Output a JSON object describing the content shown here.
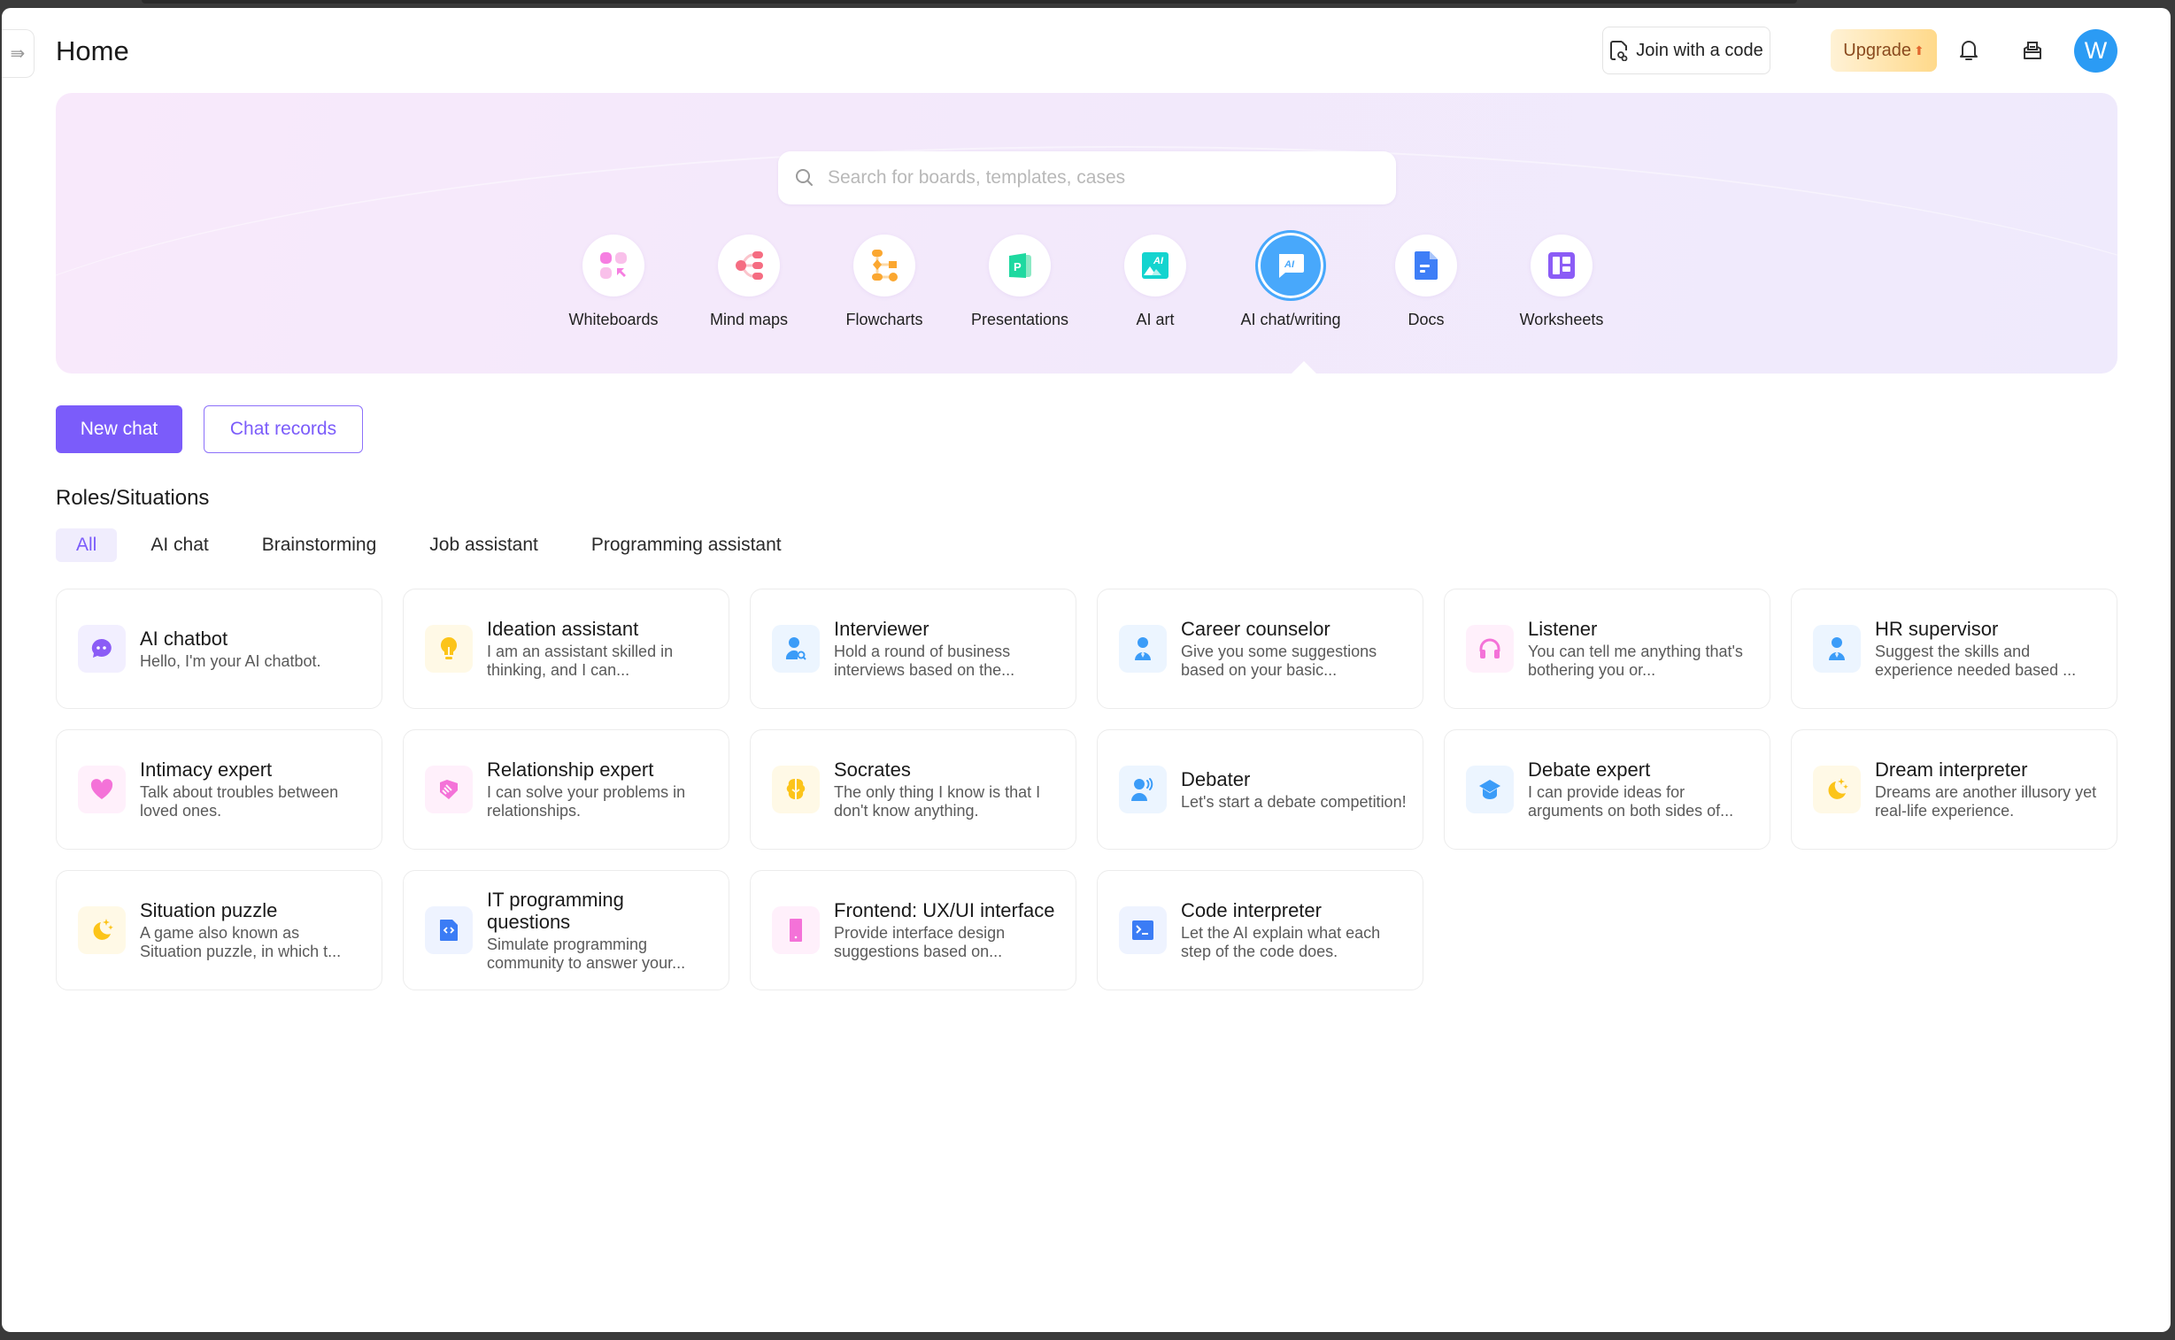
{
  "header": {
    "title": "Home",
    "join_label": "Join with a code",
    "upgrade_label": "Upgrade",
    "avatar_initial": "W"
  },
  "search": {
    "placeholder": "Search for boards, templates, cases",
    "value": ""
  },
  "categories": [
    {
      "label": "Whiteboards",
      "icon": "whiteboard-icon",
      "active": false
    },
    {
      "label": "Mind maps",
      "icon": "mind-map-icon",
      "active": false
    },
    {
      "label": "Flowcharts",
      "icon": "flowchart-icon",
      "active": false
    },
    {
      "label": "Presentations",
      "icon": "presentation-icon",
      "active": false
    },
    {
      "label": "AI art",
      "icon": "ai-art-icon",
      "active": false
    },
    {
      "label": "AI chat/writing",
      "icon": "ai-chat-icon",
      "active": true
    },
    {
      "label": "Docs",
      "icon": "doc-icon",
      "active": false
    },
    {
      "label": "Worksheets",
      "icon": "worksheet-icon",
      "active": false
    }
  ],
  "actions": {
    "new_chat": "New chat",
    "chat_records": "Chat records"
  },
  "roles": {
    "title": "Roles/Situations",
    "filters": [
      "All",
      "AI chat",
      "Brainstorming",
      "Job assistant",
      "Programming assistant"
    ],
    "active_filter": "All",
    "cards": [
      {
        "title": "AI chatbot",
        "desc": "Hello, I'm your AI chatbot.",
        "icon": "chat-bubble-icon",
        "color": "#8b5cf6"
      },
      {
        "title": "Ideation assistant",
        "desc": "I am an assistant skilled in thinking, and I can...",
        "icon": "lightbulb-icon",
        "color": "#fcc419"
      },
      {
        "title": "Interviewer",
        "desc": "Hold a round of business interviews based on the...",
        "icon": "person-search-icon",
        "color": "#3b9cf8"
      },
      {
        "title": "Career counselor",
        "desc": "Give you some suggestions based on your basic...",
        "icon": "person-icon",
        "color": "#3b9cf8"
      },
      {
        "title": "Listener",
        "desc": "You can tell me anything that's bothering you or...",
        "icon": "headphones-icon",
        "color": "#f472d8"
      },
      {
        "title": "HR supervisor",
        "desc": "Suggest the skills and experience needed based ...",
        "icon": "person-icon",
        "color": "#3b9cf8"
      },
      {
        "title": "Intimacy expert",
        "desc": "Talk about troubles between loved ones.",
        "icon": "heart-icon",
        "color": "#f472d8"
      },
      {
        "title": "Relationship expert",
        "desc": "I can solve your problems in relationships.",
        "icon": "handshake-icon",
        "color": "#f472d8"
      },
      {
        "title": "Socrates",
        "desc": "The only thing I know is that I don't know anything.",
        "icon": "brain-icon",
        "color": "#fcc419"
      },
      {
        "title": "Debater",
        "desc": "Let's start a debate competition!",
        "icon": "speaker-person-icon",
        "color": "#3b9cf8"
      },
      {
        "title": "Debate expert",
        "desc": "I can provide ideas for arguments on both sides of...",
        "icon": "graduation-cap-icon",
        "color": "#3b9cf8"
      },
      {
        "title": "Dream interpreter",
        "desc": "Dreams are another illusory yet real-life experience.",
        "icon": "moon-stars-icon",
        "color": "#fcc419"
      },
      {
        "title": "Situation puzzle",
        "desc": "A game also known as Situation puzzle, in which t...",
        "icon": "moon-stars-icon",
        "color": "#fcc419"
      },
      {
        "title": "IT programming questions",
        "desc": "Simulate programming community to answer your...",
        "icon": "code-file-icon",
        "color": "#3b7cf5"
      },
      {
        "title": "Frontend: UX/UI interface",
        "desc": "Provide interface design suggestions based on...",
        "icon": "mobile-icon",
        "color": "#f472d8"
      },
      {
        "title": "Code interpreter",
        "desc": "Let the AI explain what each step of the code does.",
        "icon": "terminal-icon",
        "color": "#3b7cf5"
      }
    ]
  }
}
